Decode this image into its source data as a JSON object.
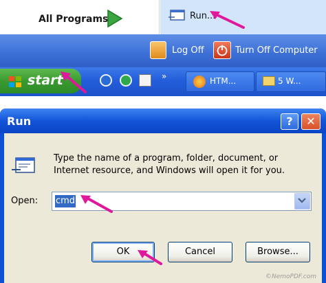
{
  "start_menu": {
    "all_programs_label": "All Programs",
    "run_label": "Run...",
    "log_off_label": "Log Off",
    "turn_off_label": "Turn Off Computer"
  },
  "taskbar": {
    "start_label": "start",
    "task_items": [
      {
        "label": "HTM...",
        "icon": "firefox-icon"
      },
      {
        "label": "5 W...",
        "icon": "folder-icon"
      }
    ],
    "quick_launch_icons": [
      "outlook-icon",
      "internet-icon",
      "notepad-icon"
    ],
    "chevron_label": "»"
  },
  "run_dialog": {
    "title": "Run",
    "help_label": "?",
    "close_label": "✕",
    "prompt_line1": "Type the name of a program, folder, document, or",
    "prompt_line2": "Internet resource, and Windows will open it for you.",
    "open_label": "Open:",
    "open_value": "cmd",
    "ok_label": "OK",
    "cancel_label": "Cancel",
    "browse_label": "Browse..."
  },
  "annotation_color": "#e0189b",
  "watermark": "©NemoPDF.com"
}
